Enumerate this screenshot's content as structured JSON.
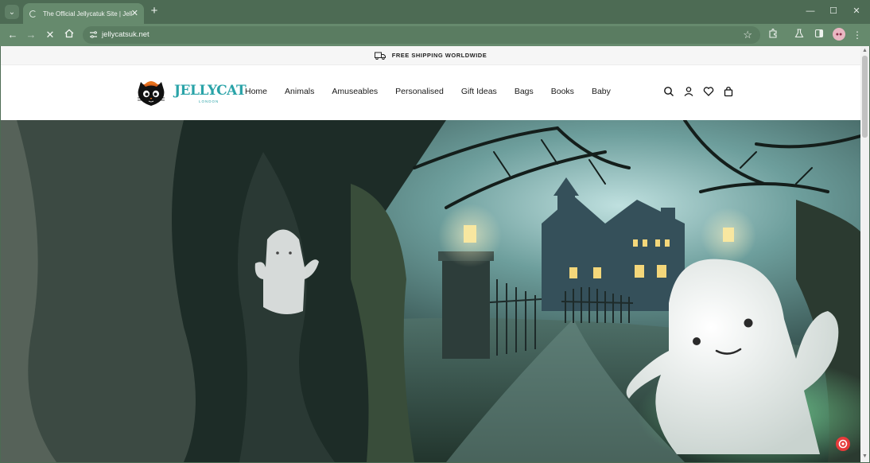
{
  "browser": {
    "tab_title": "The Official Jellycatuk Site | Jelly",
    "url": "jellycatsuk.net"
  },
  "site": {
    "shipping_banner": "FREE SHIPPING WORLDWIDE",
    "logo_text": "JELLYCAT",
    "logo_sub": "LONDON",
    "nav": [
      "Home",
      "Animals",
      "Amuseables",
      "Personalised",
      "Gift Ideas",
      "Bags",
      "Books",
      "Baby"
    ]
  },
  "colors": {
    "chrome": "#4d6b54",
    "toolbar": "#668a6d",
    "brand_teal": "#2aa3a8"
  }
}
